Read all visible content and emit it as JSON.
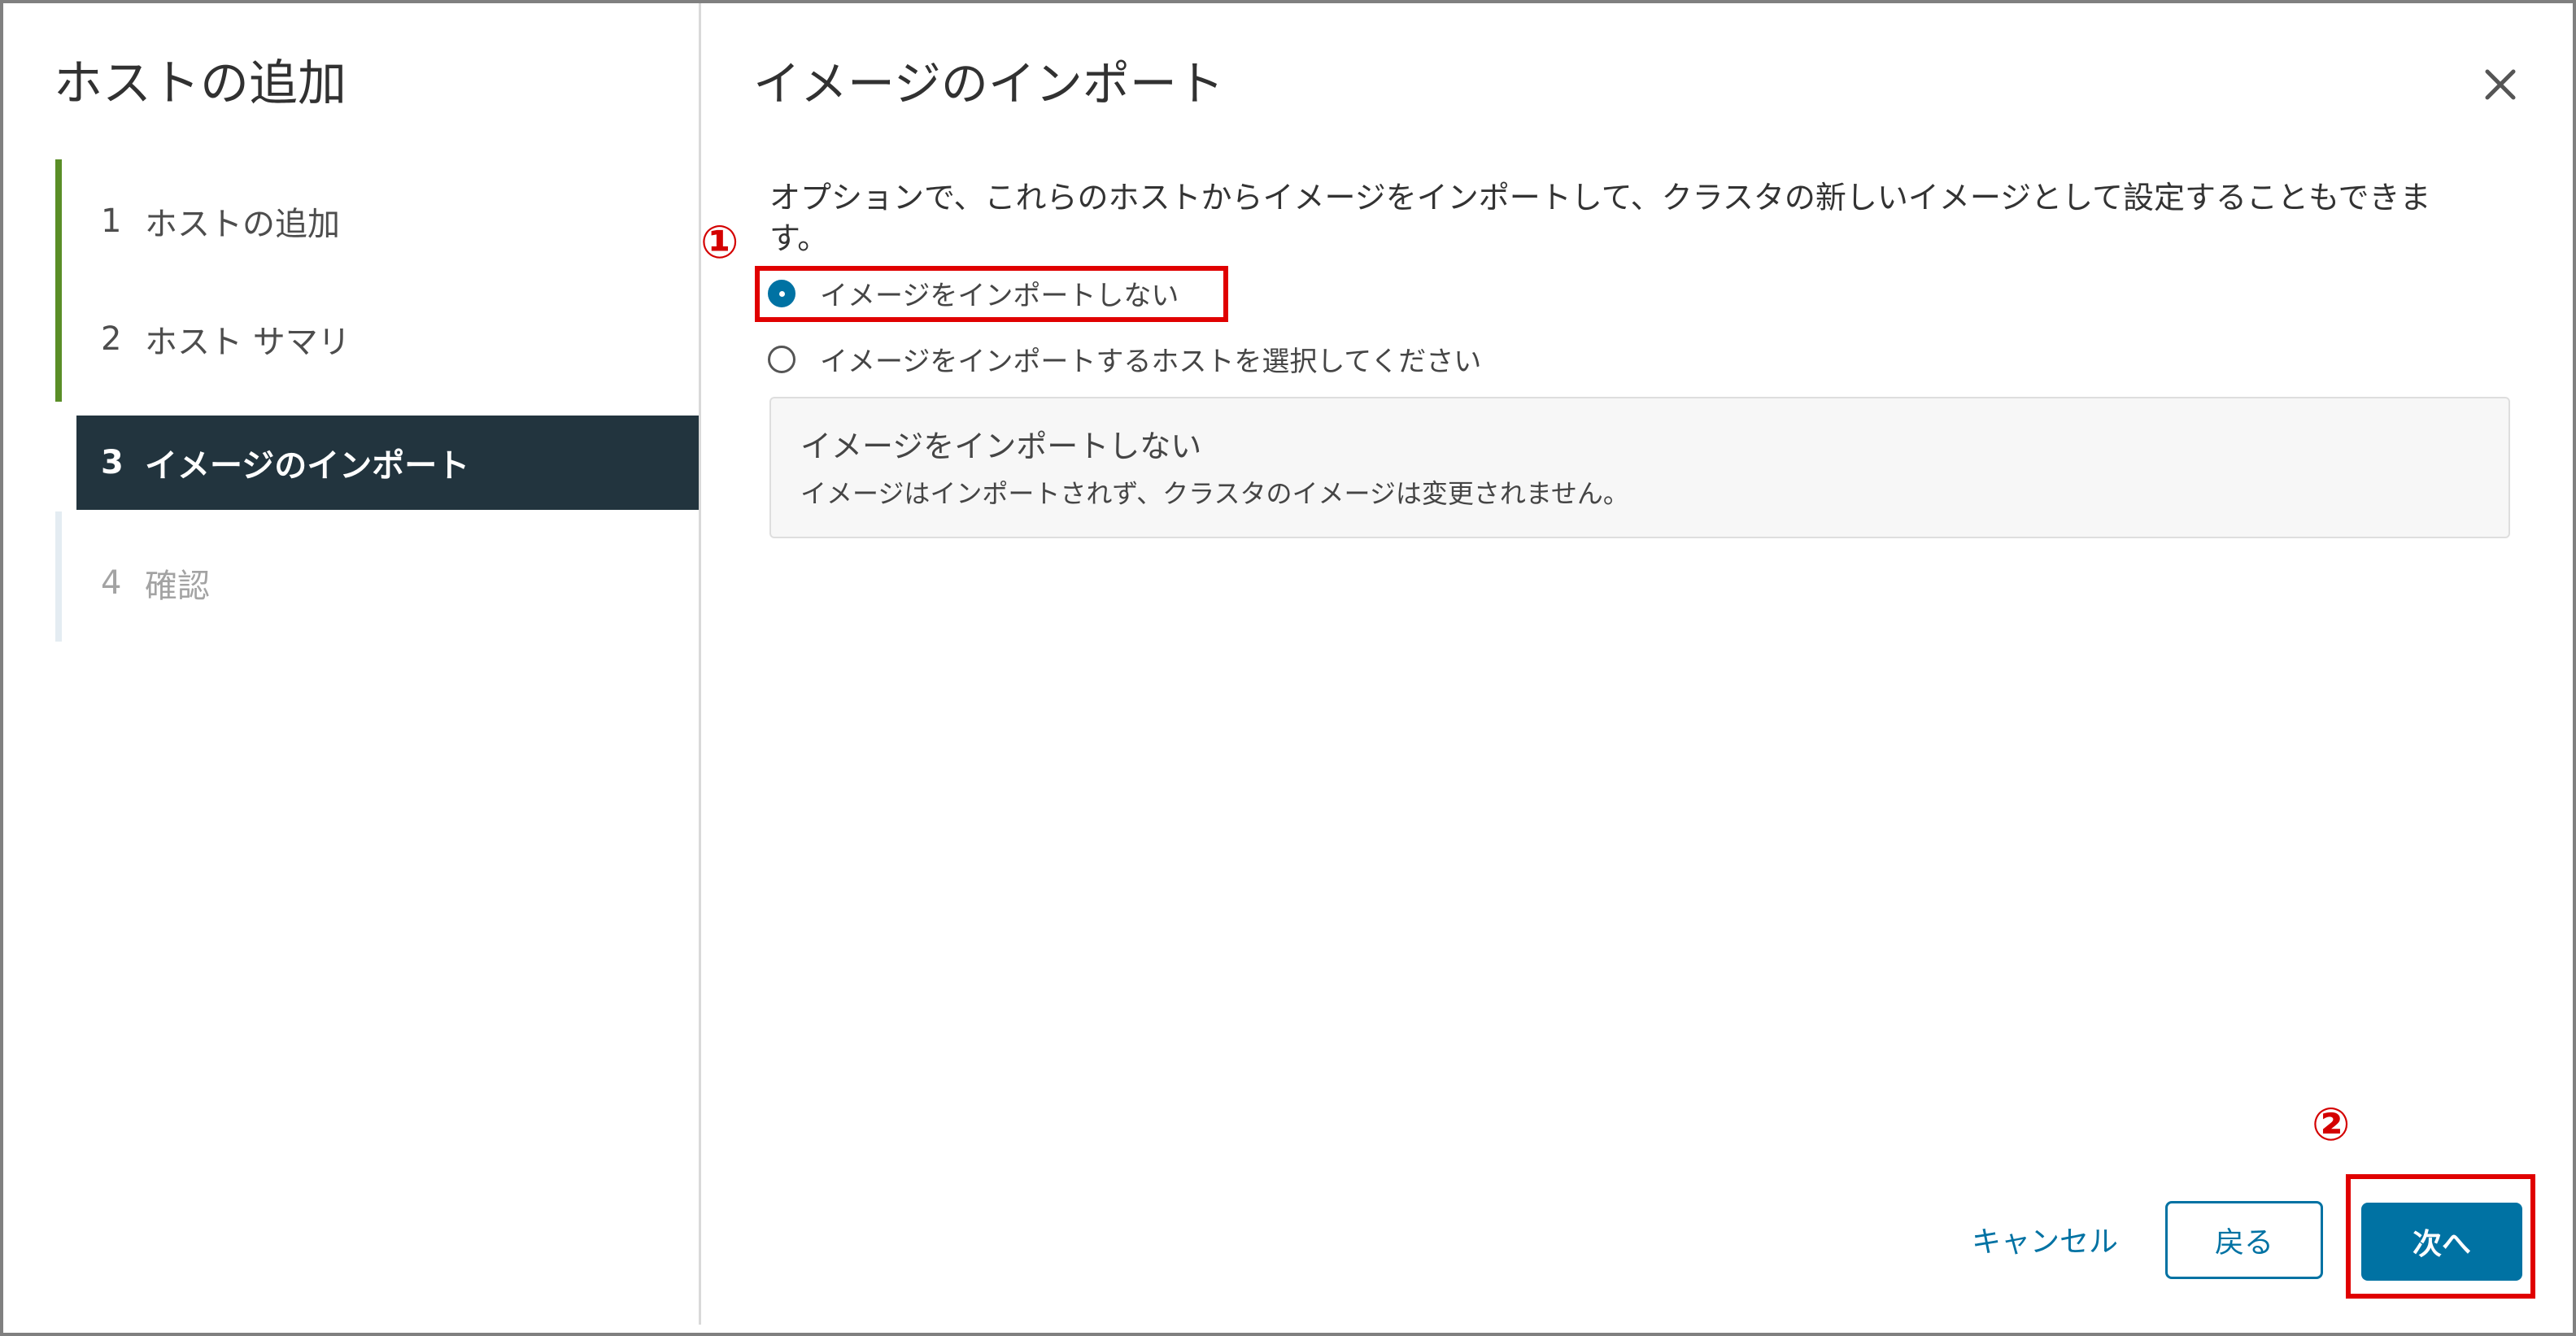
{
  "wizard": {
    "title": "ホストの追加",
    "steps": [
      {
        "number": "1",
        "label": "ホストの追加",
        "state": "completed"
      },
      {
        "number": "2",
        "label": "ホスト サマリ",
        "state": "completed"
      },
      {
        "number": "3",
        "label": "イメージのインポート",
        "state": "active"
      },
      {
        "number": "4",
        "label": "確認",
        "state": "pending"
      }
    ]
  },
  "main": {
    "title": "イメージのインポート",
    "description": "オプションで、これらのホストからイメージをインポートして、クラスタの新しいイメージとして設定することもできます。",
    "options": [
      {
        "label": "イメージをインポートしない",
        "selected": true
      },
      {
        "label": "イメージをインポートするホストを選択してください",
        "selected": false
      }
    ],
    "info_box": {
      "title": "イメージをインポートしない",
      "text": "イメージはインポートされず、クラスタのイメージは変更されません。"
    }
  },
  "footer": {
    "cancel_label": "キャンセル",
    "back_label": "戻る",
    "next_label": "次へ"
  },
  "annotations": {
    "marker_1": "①",
    "marker_2": "②"
  },
  "icons": {
    "close": "close-icon"
  },
  "colors": {
    "accent": "#0072a3",
    "active_step_bg": "#22343e",
    "completed_rail": "#5a8e27",
    "annotation_red": "#e00000"
  }
}
